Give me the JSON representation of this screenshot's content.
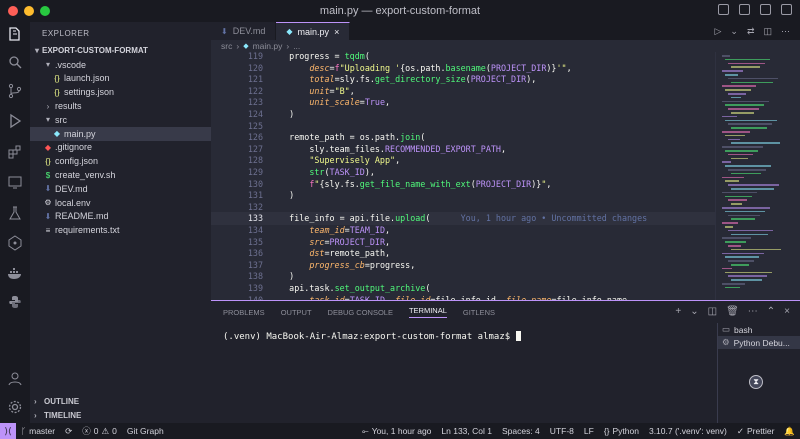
{
  "window": {
    "title": "main.py — export-custom-format"
  },
  "colors": {
    "accent": "#bd93f9",
    "close": "#ff5f57",
    "minimize": "#febc2e",
    "zoom": "#28c840"
  },
  "activity_bar": [
    "explorer-icon",
    "search-icon",
    "source-control-icon",
    "run-debug-icon",
    "extensions-icon",
    "remote-explorer-icon",
    "testing-icon",
    "gitlens-icon",
    "docker-icon",
    "python-icon",
    "accounts-icon",
    "settings-gear-icon"
  ],
  "sidebar": {
    "header": "EXPLORER",
    "root": "EXPORT-CUSTOM-FORMAT",
    "items": [
      {
        "label": ".vscode",
        "kind": "folder",
        "open": true,
        "depth": 1
      },
      {
        "label": "launch.json",
        "kind": "json",
        "depth": 2
      },
      {
        "label": "settings.json",
        "kind": "json",
        "depth": 2
      },
      {
        "label": "results",
        "kind": "folder",
        "open": false,
        "depth": 1
      },
      {
        "label": "src",
        "kind": "folder",
        "open": true,
        "depth": 1
      },
      {
        "label": "main.py",
        "kind": "python",
        "depth": 2,
        "selected": true
      },
      {
        "label": ".gitignore",
        "kind": "git",
        "depth": 1
      },
      {
        "label": "config.json",
        "kind": "json",
        "depth": 1
      },
      {
        "label": "create_venv.sh",
        "kind": "shell",
        "depth": 1
      },
      {
        "label": "DEV.md",
        "kind": "markdown",
        "depth": 1
      },
      {
        "label": "local.env",
        "kind": "env",
        "depth": 1
      },
      {
        "label": "README.md",
        "kind": "markdown",
        "depth": 1
      },
      {
        "label": "requirements.txt",
        "kind": "text",
        "depth": 1
      }
    ],
    "outline": "OUTLINE",
    "timeline": "TIMELINE"
  },
  "tabs": [
    {
      "label": "DEV.md",
      "active": false
    },
    {
      "label": "main.py",
      "active": true
    }
  ],
  "breadcrumb": [
    "src",
    "main.py",
    "..."
  ],
  "editor": {
    "lines": [
      {
        "n": "119",
        "html": "    progress = <span class='f'>tqdm</span>("
      },
      {
        "n": "120",
        "html": "        <span class='p'>desc</span>=<span class='k'>f</span><span class='s'>\"Uploading '</span>{os.path.<span class='f'>basename</span>(<span class='v'>PROJECT_DIR</span>)}<span class='s'>'\"</span>,"
      },
      {
        "n": "121",
        "html": "        <span class='p'>total</span>=sly.fs.<span class='f'>get_directory_size</span>(<span class='v'>PROJECT_DIR</span>),"
      },
      {
        "n": "122",
        "html": "        <span class='p'>unit</span>=<span class='s'>\"B\"</span>,"
      },
      {
        "n": "123",
        "html": "        <span class='p'>unit_scale</span>=<span class='v'>True</span>,"
      },
      {
        "n": "124",
        "html": "    )"
      },
      {
        "n": "125",
        "html": ""
      },
      {
        "n": "126",
        "html": "    remote_path = os.path.<span class='f'>join</span>("
      },
      {
        "n": "127",
        "html": "        sly.team_files.<span class='v'>RECOMMENDED_EXPORT_PATH</span>,"
      },
      {
        "n": "128",
        "html": "        <span class='s'>\"Supervisely App\"</span>,"
      },
      {
        "n": "129",
        "html": "        <span class='f'>str</span>(<span class='v'>TASK_ID</span>),"
      },
      {
        "n": "130",
        "html": "        <span class='k'>f</span><span class='s'>\"</span>{sly.fs.<span class='f'>get_file_name_with_ext</span>(<span class='v'>PROJECT_DIR</span>)}<span class='s'>\"</span>,"
      },
      {
        "n": "131",
        "html": "    )"
      },
      {
        "n": "132",
        "html": ""
      },
      {
        "n": "133",
        "html": "    file_info = api.file.<span class='f'>upload</span>(      <span class='c'>You, 1 hour ago • Uncommitted changes</span>",
        "active": true
      },
      {
        "n": "134",
        "html": "        <span class='p'>team_id</span>=<span class='v'>TEAM_ID</span>,"
      },
      {
        "n": "135",
        "html": "        <span class='p'>src</span>=<span class='v'>PROJECT_DIR</span>,"
      },
      {
        "n": "136",
        "html": "        <span class='p'>dst</span>=remote_path,"
      },
      {
        "n": "137",
        "html": "        <span class='p'>progress_cb</span>=progress,"
      },
      {
        "n": "138",
        "html": "    )"
      },
      {
        "n": "139",
        "html": "    api.task.<span class='f'>set_output_archive</span>("
      },
      {
        "n": "140",
        "html": "        <span class='p'>task_id</span>=<span class='v'>TASK_ID</span>, <span class='p'>file_id</span>=file_info.id, <span class='p'>file_name</span>=file_info.name,"
      }
    ]
  },
  "panel": {
    "tabs": [
      "PROBLEMS",
      "OUTPUT",
      "DEBUG CONSOLE",
      "TERMINAL",
      "GITLENS"
    ],
    "active_tab": "TERMINAL",
    "prompt": "(.venv) MacBook-Air-Almaz:export-custom-format almaz$ ",
    "terminals": [
      "bash",
      "Python Debu..."
    ]
  },
  "statusbar": {
    "branch": "master",
    "errors": "0",
    "warnings": "0",
    "git_graph": "Git Graph",
    "blame": "You, 1 hour ago",
    "cursor": "Ln 133, Col 1",
    "spaces": "Spaces: 4",
    "encoding": "UTF-8",
    "eol": "LF",
    "language": "Python",
    "interpreter": "3.10.7 ('.venv': venv)",
    "prettier": "Prettier"
  }
}
